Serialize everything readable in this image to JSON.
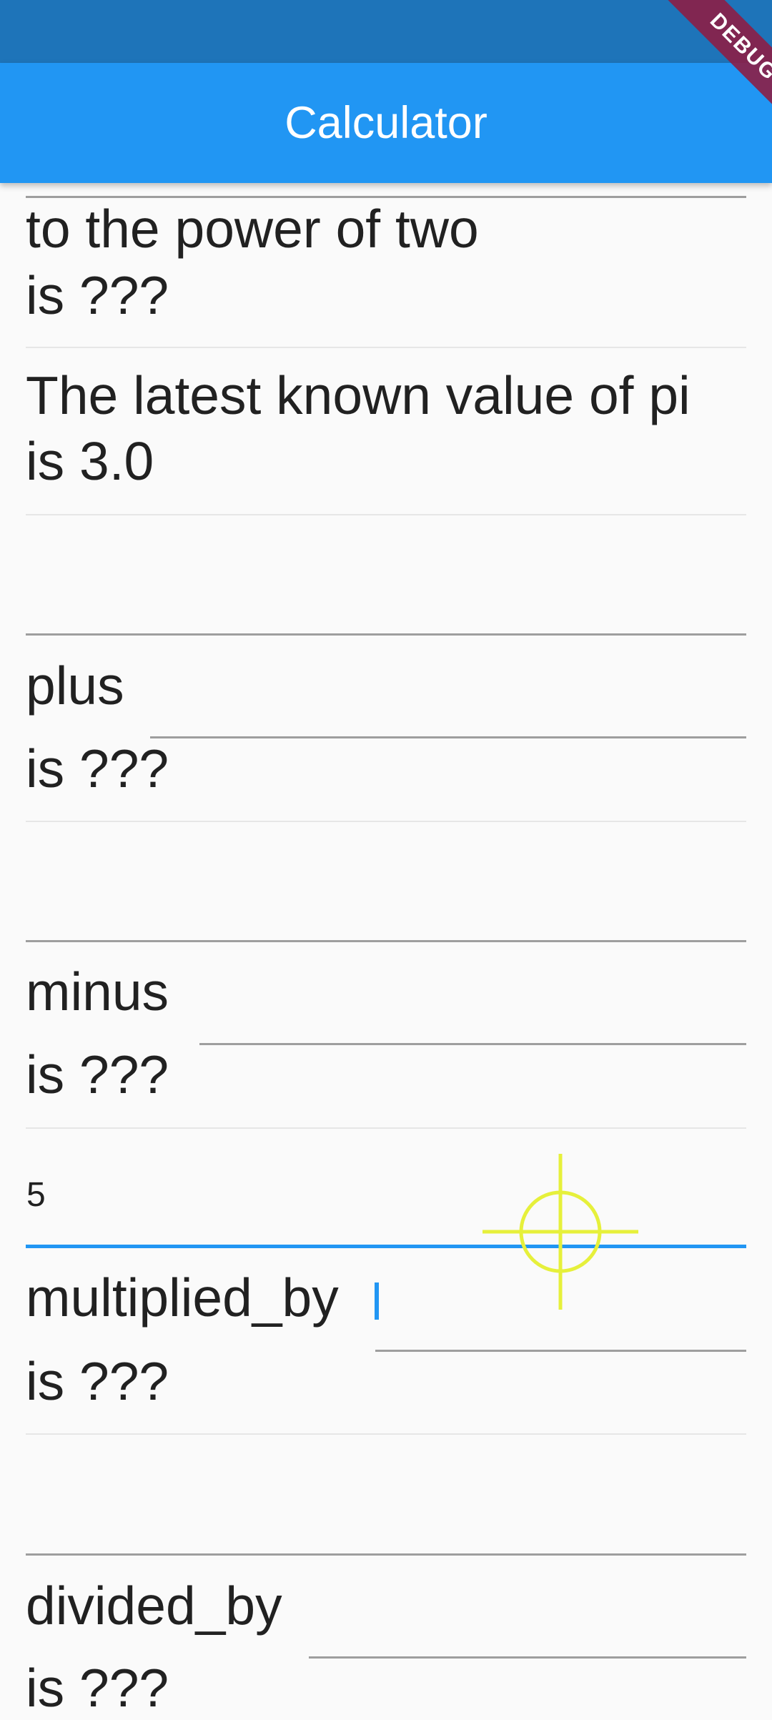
{
  "app_bar": {
    "title": "Calculator",
    "debug_label": "DEBUG"
  },
  "rows": [
    {
      "label": "to the power of two",
      "result": "is ???"
    },
    {
      "label": "The latest known value of pi",
      "result": "is 3.0"
    },
    {
      "label": "plus",
      "result": "is ???"
    },
    {
      "label": "minus",
      "result": "is ???"
    },
    {
      "label": "multiplied_by",
      "result": "is ???",
      "input_value": "5"
    },
    {
      "label": "divided_by",
      "result": "is ???"
    }
  ],
  "colors": {
    "accent": "#2196f3",
    "status_bar": "#1e74b9",
    "crosshair": "#e6f03b"
  }
}
